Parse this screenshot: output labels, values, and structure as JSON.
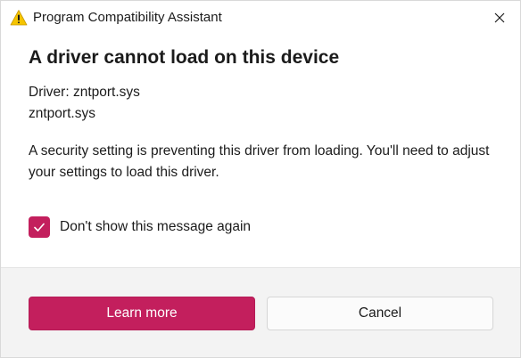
{
  "window": {
    "title": "Program Compatibility Assistant",
    "title_icon": "warning-icon",
    "close_icon": "close-icon"
  },
  "dialog": {
    "heading": "A driver cannot load on this device",
    "driver_line": "Driver: zntport.sys",
    "file_line": "zntport.sys",
    "message": "A security setting is preventing this driver from loading. You'll need to adjust your settings to load this driver."
  },
  "checkbox": {
    "label": "Don't show this message again",
    "checked": true
  },
  "buttons": {
    "learn_more": "Learn more",
    "cancel": "Cancel"
  },
  "colors": {
    "accent": "#c31f5d",
    "footer_bg": "#f3f3f3",
    "warning_yellow": "#f5c400"
  }
}
